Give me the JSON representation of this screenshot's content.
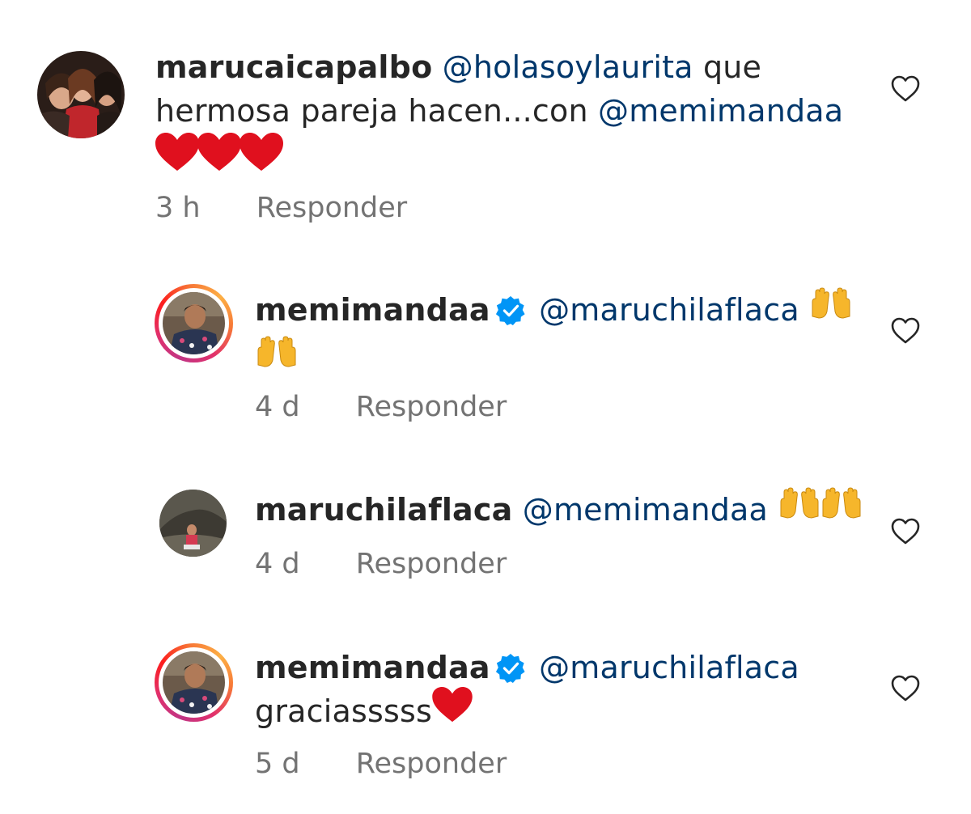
{
  "comments": [
    {
      "username": "marucaicapalbo",
      "mention": "@holasoylaurita",
      "text_a": " que",
      "text_b": "hermosa pareja hacen...con ",
      "mention2": "@memimandaa",
      "emoji": "❤❤❤",
      "time": "3 h",
      "reply": "Responder",
      "verified": false
    },
    {
      "username": "memimandaa",
      "mention": "@maruchilaflaca",
      "emoji": "🙌🙌",
      "time": "4 d",
      "reply": "Responder",
      "verified": true
    },
    {
      "username": "maruchilaflaca",
      "mention": "@memimandaa",
      "emoji": "🙌🙌🙌",
      "time": "4 d",
      "reply": "Responder",
      "verified": false
    },
    {
      "username": "memimandaa",
      "mention": "@maruchilaflaca",
      "text": "graciasssss",
      "emoji": "❤",
      "time": "5 d",
      "reply": "Responder",
      "verified": true
    }
  ],
  "icons": {
    "like": "heart-outline-icon",
    "verified": "verified-badge-icon"
  },
  "colors": {
    "mention": "#00376b",
    "verified": "#0095f6",
    "heart": "#ed4956",
    "meta": "#737373"
  }
}
